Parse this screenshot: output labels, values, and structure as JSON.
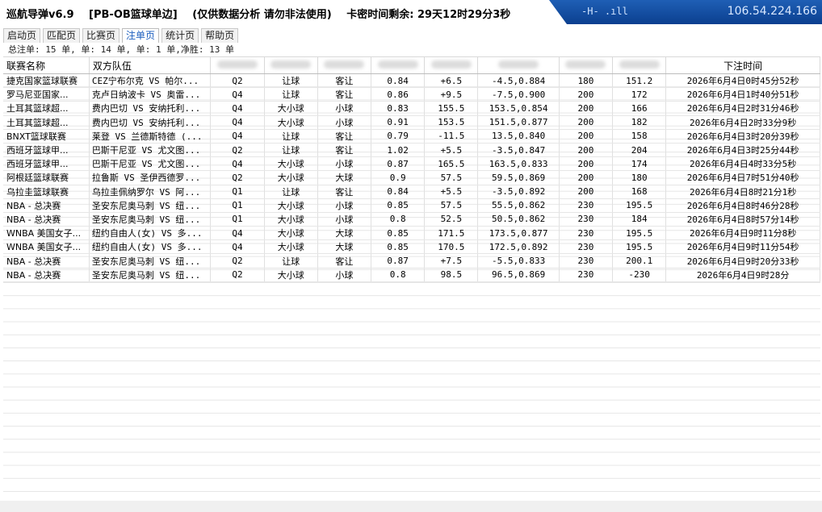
{
  "title": {
    "app_name": "巡航导弹v6.9",
    "module": "[PB-OB篮球单边]",
    "notice": "(仅供数据分析 请勿非法使用)",
    "card_time": "卡密时间剩余: 29天12时29分3秒"
  },
  "network": {
    "icon_text": "-H- .ıll",
    "ip": "106.54.224.166"
  },
  "tabs": [
    {
      "label": "启动页"
    },
    {
      "label": "匹配页"
    },
    {
      "label": "比赛页"
    },
    {
      "label": "注单页"
    },
    {
      "label": "统计页"
    },
    {
      "label": "帮助页"
    }
  ],
  "summary": "总注单: 15 单,  单: 14 单,  单: 1 单,净胜: 13 单",
  "table": {
    "headers": [
      "联赛名称",
      "双方队伍",
      "",
      "",
      "",
      "",
      "",
      "",
      "",
      "",
      "下注时间"
    ],
    "rows": [
      [
        "捷克国家篮球联赛",
        "CEZ宁布尔克 VS 帕尔...",
        "Q2",
        "让球",
        "客让",
        "0.84",
        "+6.5",
        "-4.5,0.884",
        "180",
        "151.2",
        "2026年6月4日0时45分52秒"
      ],
      [
        "罗马尼亚国家...",
        "克卢日纳波卡 VS 奥雷...",
        "Q4",
        "让球",
        "客让",
        "0.86",
        "+9.5",
        "-7.5,0.900",
        "200",
        "172",
        "2026年6月4日1时40分51秒"
      ],
      [
        "土耳其篮球超...",
        "费内巴切 VS 安纳托利...",
        "Q4",
        "大小球",
        "小球",
        "0.83",
        "155.5",
        "153.5,0.854",
        "200",
        "166",
        "2026年6月4日2时31分46秒"
      ],
      [
        "土耳其篮球超...",
        "费内巴切 VS 安纳托利...",
        "Q4",
        "大小球",
        "小球",
        "0.91",
        "153.5",
        "151.5,0.877",
        "200",
        "182",
        "2026年6月4日2时33分9秒"
      ],
      [
        "BNXT篮球联赛",
        "莱登 VS 兰德斯特德 (...",
        "Q4",
        "让球",
        "客让",
        "0.79",
        "-11.5",
        "13.5,0.840",
        "200",
        "158",
        "2026年6月4日3时20分39秒"
      ],
      [
        "西班牙篮球甲...",
        "巴斯干尼亚 VS 尤文图...",
        "Q2",
        "让球",
        "客让",
        "1.02",
        "+5.5",
        "-3.5,0.847",
        "200",
        "204",
        "2026年6月4日3时25分44秒"
      ],
      [
        "西班牙篮球甲...",
        "巴斯干尼亚 VS 尤文图...",
        "Q4",
        "大小球",
        "小球",
        "0.87",
        "165.5",
        "163.5,0.833",
        "200",
        "174",
        "2026年6月4日4时33分5秒"
      ],
      [
        "阿根廷篮球联赛",
        "拉鲁斯 VS 圣伊西德罗...",
        "Q2",
        "大小球",
        "大球",
        "0.9",
        "57.5",
        "59.5,0.869",
        "200",
        "180",
        "2026年6月4日7时51分40秒"
      ],
      [
        "乌拉圭篮球联赛",
        "乌拉圭佩纳罗尔 VS 阿...",
        "Q1",
        "让球",
        "客让",
        "0.84",
        "+5.5",
        "-3.5,0.892",
        "200",
        "168",
        "2026年6月4日8时21分1秒"
      ],
      [
        "NBA - 总决赛",
        "圣安东尼奥马刺 VS 纽...",
        "Q1",
        "大小球",
        "小球",
        "0.85",
        "57.5",
        "55.5,0.862",
        "230",
        "195.5",
        "2026年6月4日8时46分28秒"
      ],
      [
        "NBA - 总决赛",
        "圣安东尼奥马刺 VS 纽...",
        "Q1",
        "大小球",
        "小球",
        "0.8",
        "52.5",
        "50.5,0.862",
        "230",
        "184",
        "2026年6月4日8时57分14秒"
      ],
      [
        "WNBA 美国女子...",
        "纽约自由人(女) VS 多...",
        "Q4",
        "大小球",
        "大球",
        "0.85",
        "171.5",
        "173.5,0.877",
        "230",
        "195.5",
        "2026年6月4日9时11分8秒"
      ],
      [
        "WNBA 美国女子...",
        "纽约自由人(女) VS 多...",
        "Q4",
        "大小球",
        "大球",
        "0.85",
        "170.5",
        "172.5,0.892",
        "230",
        "195.5",
        "2026年6月4日9时11分54秒"
      ],
      [
        "NBA - 总决赛",
        "圣安东尼奥马刺 VS 纽...",
        "Q2",
        "让球",
        "客让",
        "0.87",
        "+7.5",
        "-5.5,0.833",
        "230",
        "200.1",
        "2026年6月4日9时20分33秒"
      ],
      [
        "NBA - 总决赛",
        "圣安东尼奥马刺 VS 纽...",
        "Q2",
        "大小球",
        "小球",
        "0.8",
        "98.5",
        "96.5,0.869",
        "230",
        "-230",
        "2026年6月4日9时28分"
      ]
    ]
  }
}
